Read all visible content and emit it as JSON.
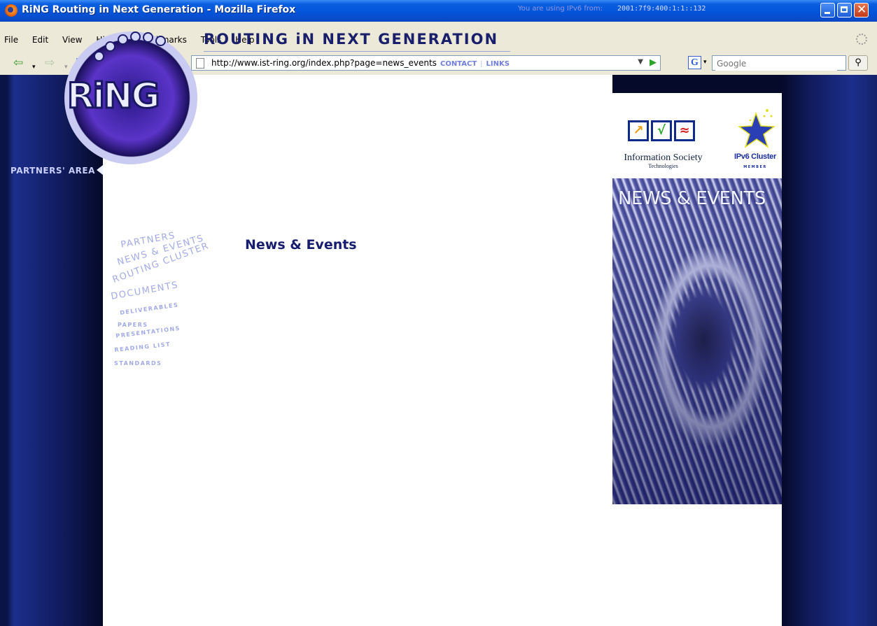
{
  "window": {
    "title": "RiNG Routing in Next Generation - Mozilla Firefox"
  },
  "menubar": {
    "items": [
      "File",
      "Edit",
      "View",
      "History",
      "Bookmarks",
      "Tools",
      "Help"
    ]
  },
  "navbar": {
    "url": "http://www.ist-ring.org/index.php?page=news_events",
    "search_placeholder": "Google",
    "icons": [
      "back-icon",
      "forward-icon",
      "reload-icon",
      "stop-icon",
      "home-icon",
      "feed-icon",
      "bookmark-icon"
    ]
  },
  "site": {
    "ipv6_label": "You are using IPv6 from:",
    "ipv6_address": "2001:7f9:400:1:1::132",
    "title": "ROUTING iN NEXT GENERATION",
    "top_links": [
      "CONTACT",
      "LINKS"
    ],
    "logo_text": "RiNG",
    "partners_area": "PARTNERS' AREA",
    "nav": [
      "PARTNERS",
      "NEWS & EVENTS",
      "ROUTING CLUSTER",
      "DOCUMENTS",
      "DELIVERABLES",
      "PAPERS",
      "PRESENTATIONS",
      "READING LIST",
      "STANDARDS"
    ],
    "heading": "News & Events",
    "ist_text": "Information Society",
    "ist_sub": "Technologies",
    "cluster_text": "IPv6 Cluster",
    "cluster_sub": "MEMBER",
    "banner_title": "NEWS & EVENTS"
  },
  "colors": {
    "page_bg": "#0a1446",
    "title": "#1a1f6b",
    "nav": "#a3aae8",
    "heading": "#161c6e"
  }
}
